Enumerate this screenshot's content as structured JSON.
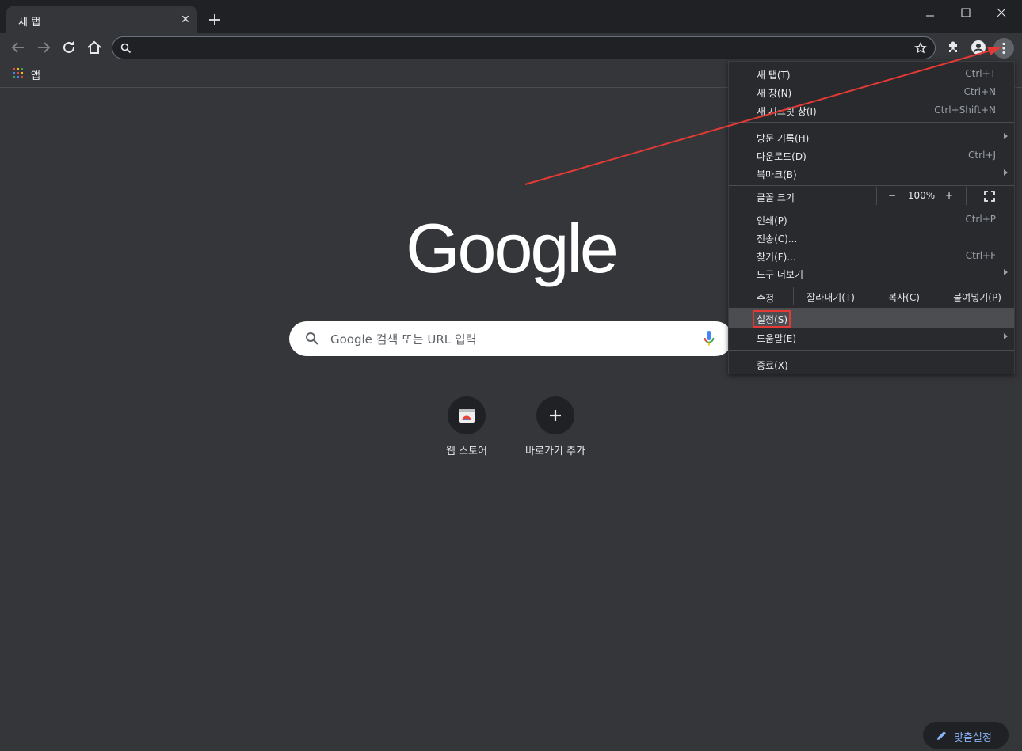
{
  "tabs": [
    {
      "title": "새 탭",
      "close": "✕"
    }
  ],
  "window_controls": [
    "minimize",
    "maximize",
    "close"
  ],
  "omnibox": {
    "value": "",
    "placeholder": ""
  },
  "bookmarks": {
    "apps_label": "앱"
  },
  "ntp": {
    "search_placeholder": "Google 검색 또는 URL 입력",
    "shortcuts": [
      {
        "label": "웹 스토어"
      },
      {
        "label": "바로가기 추가"
      }
    ],
    "customize_label": "맞춤설정"
  },
  "menu": {
    "new_tab": {
      "label": "새 탭(T)",
      "shortcut": "Ctrl+T"
    },
    "new_window": {
      "label": "새 창(N)",
      "shortcut": "Ctrl+N"
    },
    "incognito": {
      "label": "새 시크릿 창(I)",
      "shortcut": "Ctrl+Shift+N"
    },
    "history": {
      "label": "방문 기록(H)"
    },
    "downloads": {
      "label": "다운로드(D)",
      "shortcut": "Ctrl+J"
    },
    "bookmarks": {
      "label": "북마크(B)"
    },
    "zoom": {
      "label": "글꼴 크기",
      "minus": "−",
      "value": "100%",
      "plus": "+"
    },
    "print": {
      "label": "인쇄(P)",
      "shortcut": "Ctrl+P"
    },
    "cast": {
      "label": "전송(C)..."
    },
    "find": {
      "label": "찾기(F)...",
      "shortcut": "Ctrl+F"
    },
    "more_tools": {
      "label": "도구 더보기"
    },
    "edit": {
      "label": "수정",
      "cut": "잘라내기(T)",
      "copy": "복사(C)",
      "paste": "붙여넣기(P)"
    },
    "settings": {
      "label": "설정(S)"
    },
    "help": {
      "label": "도움말(E)"
    },
    "exit": {
      "label": "종료(X)"
    }
  },
  "colors": {
    "arrow": "#e53935",
    "highlight_box": "#e53935",
    "background": "#35363a"
  }
}
